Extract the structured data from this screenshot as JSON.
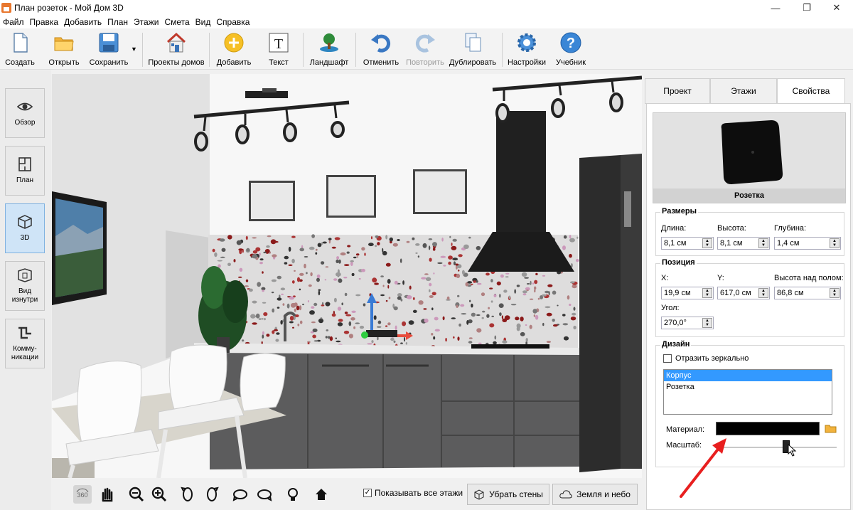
{
  "window": {
    "title": "План розеток - Мой Дом 3D"
  },
  "menu": [
    "Файл",
    "Правка",
    "Добавить",
    "План",
    "Этажи",
    "Смета",
    "Вид",
    "Справка"
  ],
  "toolbar": {
    "create": "Создать",
    "open": "Открыть",
    "save": "Сохранить",
    "projects": "Проекты домов",
    "add": "Добавить",
    "text": "Текст",
    "landscape": "Ландшафт",
    "undo": "Отменить",
    "redo": "Повторить",
    "duplicate": "Дублировать",
    "settings": "Настройки",
    "tutorial": "Учебник"
  },
  "sidebar": {
    "overview": "Обзор",
    "plan": "План",
    "view3d": "3D",
    "inside_line1": "Вид",
    "inside_line2": "изнутри",
    "comm_line1": "Комму-",
    "comm_line2": "никации"
  },
  "bottom": {
    "show_floors": "Показывать все этажи",
    "remove_walls": "Убрать стены",
    "ground_sky": "Земля и небо"
  },
  "panel": {
    "tabs": [
      "Проект",
      "Этажи",
      "Свойства"
    ],
    "active_tab": "Свойства",
    "object_name": "Розетка",
    "sizes": {
      "title": "Размеры",
      "length_label": "Длина:",
      "length": "8,1 см",
      "height_label": "Высота:",
      "height": "8,1 см",
      "depth_label": "Глубина:",
      "depth": "1,4 см"
    },
    "position": {
      "title": "Позиция",
      "x_label": "X:",
      "x": "19,9 см",
      "y_label": "Y:",
      "y": "617,0 см",
      "floor_label": "Высота над полом:",
      "floor": "86,8 см",
      "angle_label": "Угол:",
      "angle": "270,0°"
    },
    "design": {
      "title": "Дизайн",
      "mirror_label": "Отразить зеркально",
      "parts": [
        "Корпус",
        "Розетка"
      ],
      "selected_part": "Корпус",
      "material_label": "Материал:",
      "material_color": "#000000",
      "scale_label": "Масштаб:"
    }
  },
  "colors": {
    "accent": "#3399ff",
    "annotation_arrow": "#e81f1f"
  }
}
